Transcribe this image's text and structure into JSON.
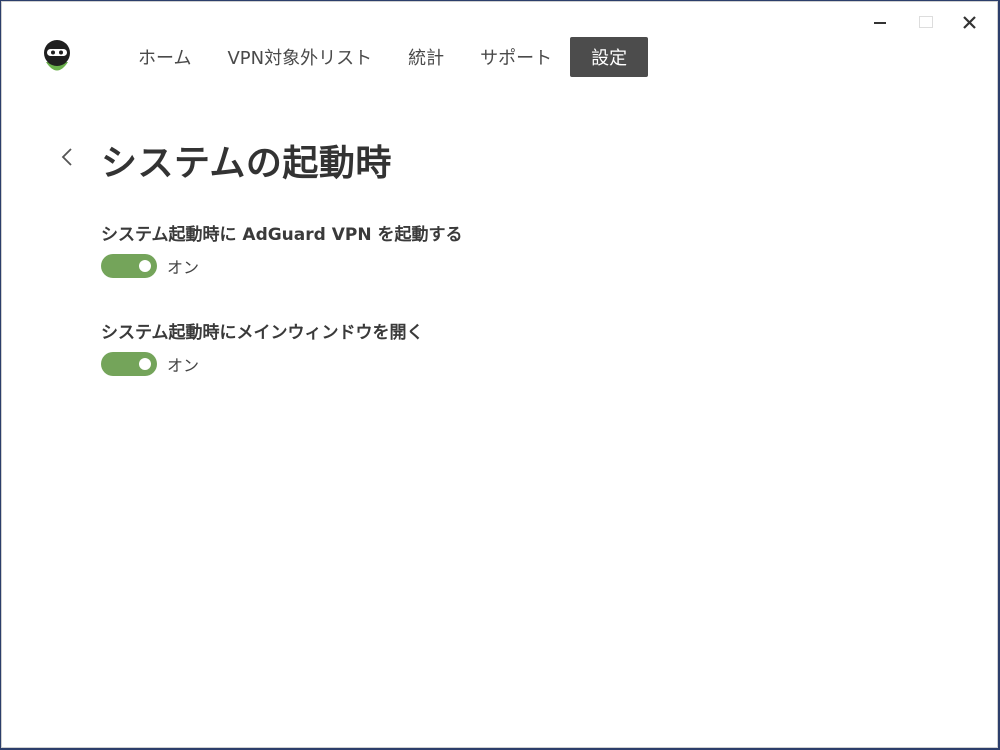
{
  "window_controls": {
    "minimize": "−",
    "maximize": "▭",
    "close": "✕"
  },
  "app": {
    "logo_icon": "adguard-ninja-icon",
    "accent_color": "#74a45a",
    "active_tab_color": "#4c4c4c"
  },
  "nav": {
    "items": [
      {
        "label": "ホーム",
        "active": false
      },
      {
        "label": "VPN対象外リスト",
        "active": false
      },
      {
        "label": "統計",
        "active": false
      },
      {
        "label": "サポート",
        "active": false
      },
      {
        "label": "設定",
        "active": true
      }
    ]
  },
  "page": {
    "back_icon": "chevron-left-icon",
    "title": "システムの起動時"
  },
  "settings": [
    {
      "label": "システム起動時に AdGuard VPN を起動する",
      "state": "オン",
      "enabled": true
    },
    {
      "label": "システム起動時にメインウィンドウを開く",
      "state": "オン",
      "enabled": true
    }
  ]
}
